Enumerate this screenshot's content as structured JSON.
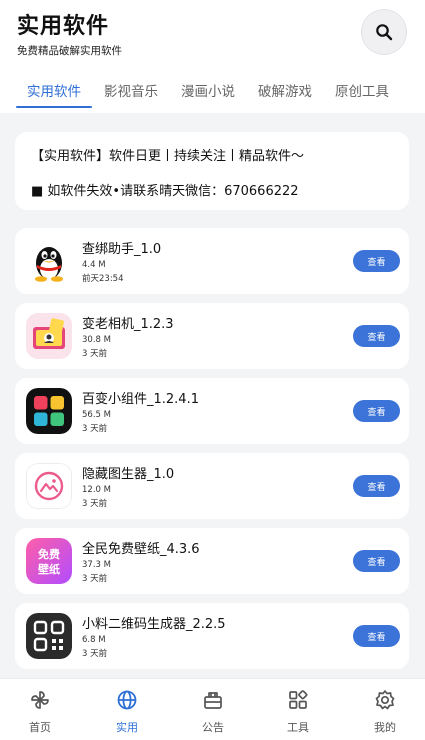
{
  "header": {
    "title": "实用软件",
    "subtitle": "免费精品破解实用软件"
  },
  "search": {
    "icon": "search-icon"
  },
  "tabs": [
    {
      "label": "实用软件",
      "active": true
    },
    {
      "label": "影视音乐",
      "active": false
    },
    {
      "label": "漫画小说",
      "active": false
    },
    {
      "label": "破解游戏",
      "active": false
    },
    {
      "label": "原创工具",
      "active": false
    }
  ],
  "notice": {
    "line1": "【实用软件】软件日更丨持续关注丨精品软件～",
    "line2": "■ 如软件失效•请联系晴天微信：670666222"
  },
  "items": [
    {
      "name": "查绑助手_1.0",
      "size": "4.4 M",
      "time": "前天23:54",
      "button": "查看",
      "icon": "qq-penguin-icon"
    },
    {
      "name": "变老相机_1.2.3",
      "size": "30.8 M",
      "time": "3 天前",
      "button": "查看",
      "icon": "camera-photo-icon"
    },
    {
      "name": "百变小组件_1.2.4.1",
      "size": "56.5 M",
      "time": "3 天前",
      "button": "查看",
      "icon": "widget-grid-icon"
    },
    {
      "name": "隐藏图生器_1.0",
      "size": "12.0 M",
      "time": "3 天前",
      "button": "查看",
      "icon": "image-mountain-icon"
    },
    {
      "name": "全民免费壁纸_4.3.6",
      "size": "37.3 M",
      "time": "3 天前",
      "button": "查看",
      "icon": "wallpaper-icon",
      "icon_text": [
        "免费",
        "壁纸"
      ]
    },
    {
      "name": "小料二维码生成器_2.2.5",
      "size": "6.8 M",
      "time": "3 天前",
      "button": "查看",
      "icon": "qr-code-icon"
    }
  ],
  "nav": [
    {
      "label": "首页",
      "icon": "pinwheel-icon",
      "active": false
    },
    {
      "label": "实用",
      "icon": "globe-icon",
      "active": true
    },
    {
      "label": "公告",
      "icon": "megaphone-icon",
      "active": false
    },
    {
      "label": "工具",
      "icon": "apps-grid-icon",
      "active": false
    },
    {
      "label": "我的",
      "icon": "settings-icon",
      "active": false
    }
  ],
  "colors": {
    "accent": "#2f6fd6",
    "button": "#3b73d9",
    "background": "#f3f4f6"
  }
}
